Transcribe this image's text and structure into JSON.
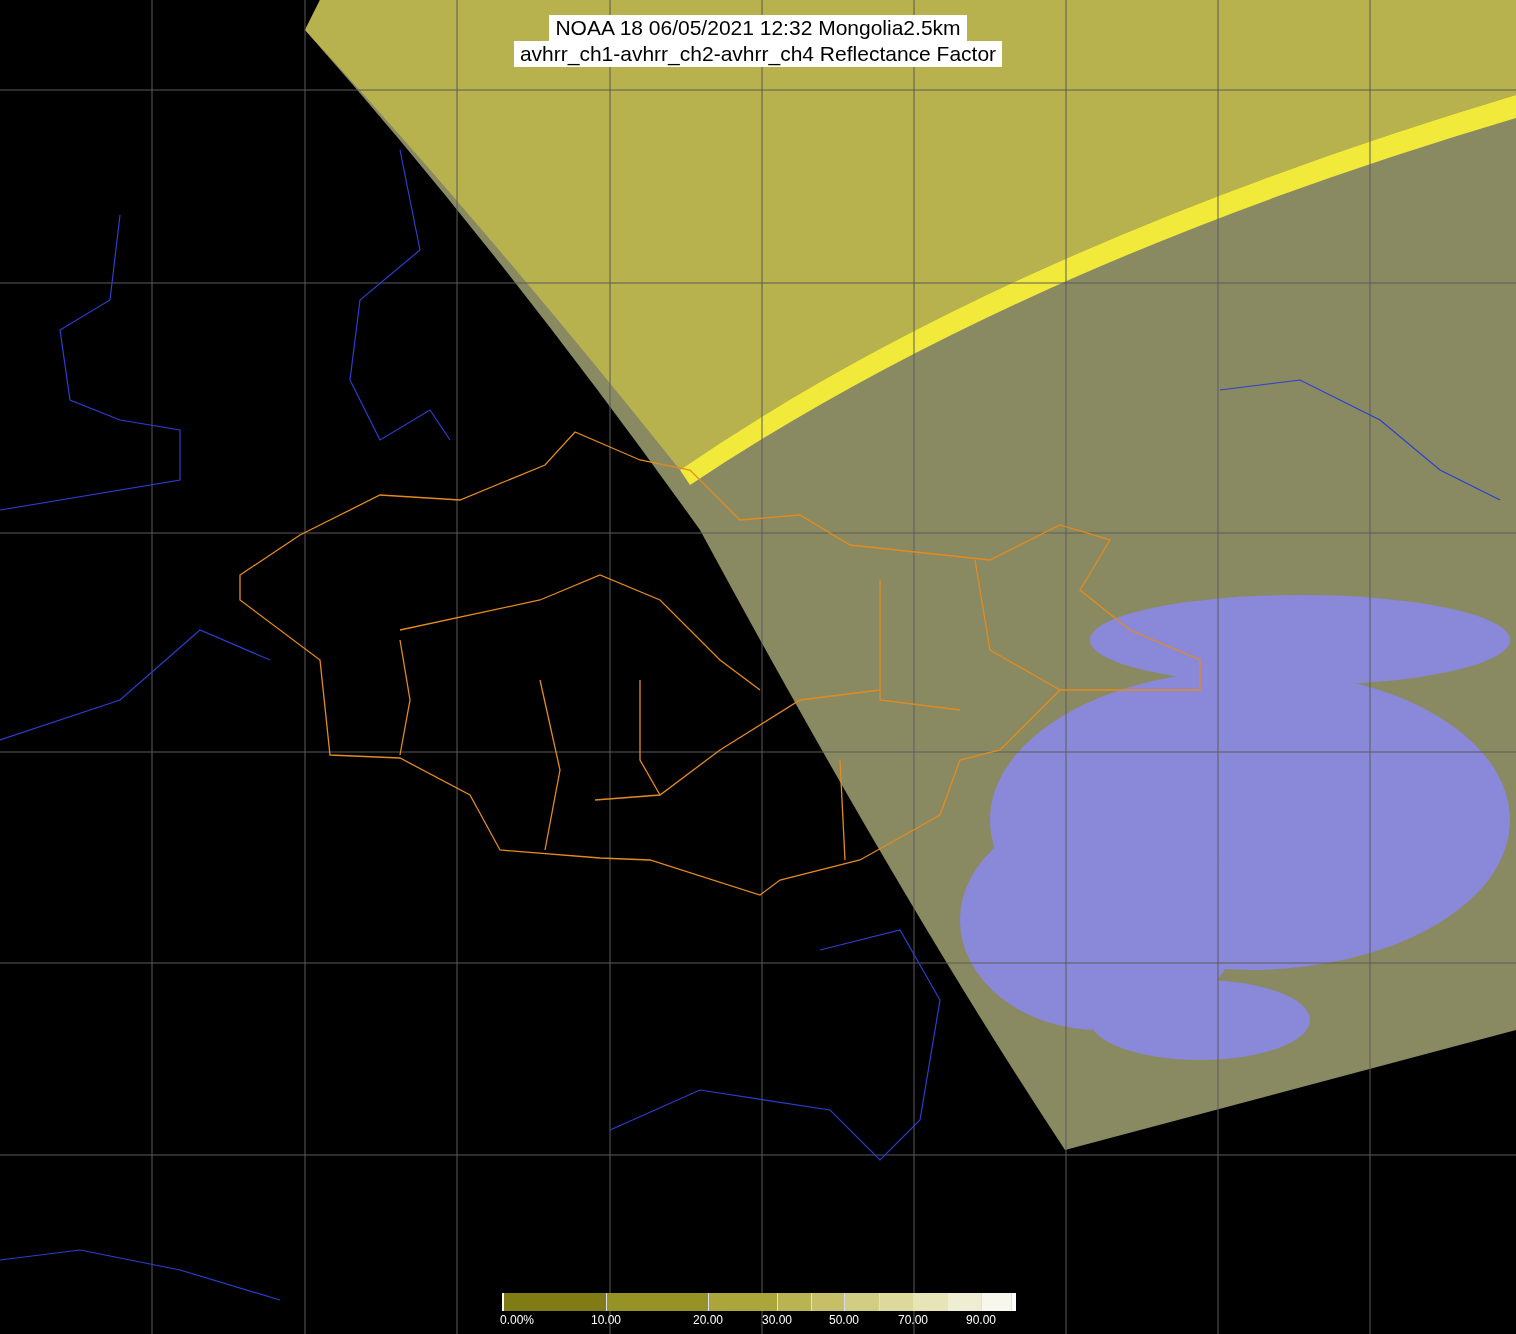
{
  "title": {
    "lines": [
      "NOAA 18 06/05/2021 12:32 Mongolia2.5km",
      "avhrr_ch1-avhrr_ch2-avhrr_ch4 Reflectance Factor"
    ]
  },
  "colorbar": {
    "segments": [
      {
        "color": "#7f7c16",
        "label": "0.00%"
      },
      {
        "color": "#959226",
        "label": "10.00"
      },
      {
        "color": "#aba63c",
        "label": "20.00"
      },
      {
        "color": "#b9b452",
        "label": "30.00"
      },
      {
        "color": "#c5c068"
      },
      {
        "color": "#d1cd82",
        "label": "50.00"
      },
      {
        "color": "#ddd99c"
      },
      {
        "color": "#e7e4b8",
        "label": "70.00"
      },
      {
        "color": "#f0eed2"
      },
      {
        "color": "#f8f7ec",
        "label": "90.00"
      }
    ]
  }
}
